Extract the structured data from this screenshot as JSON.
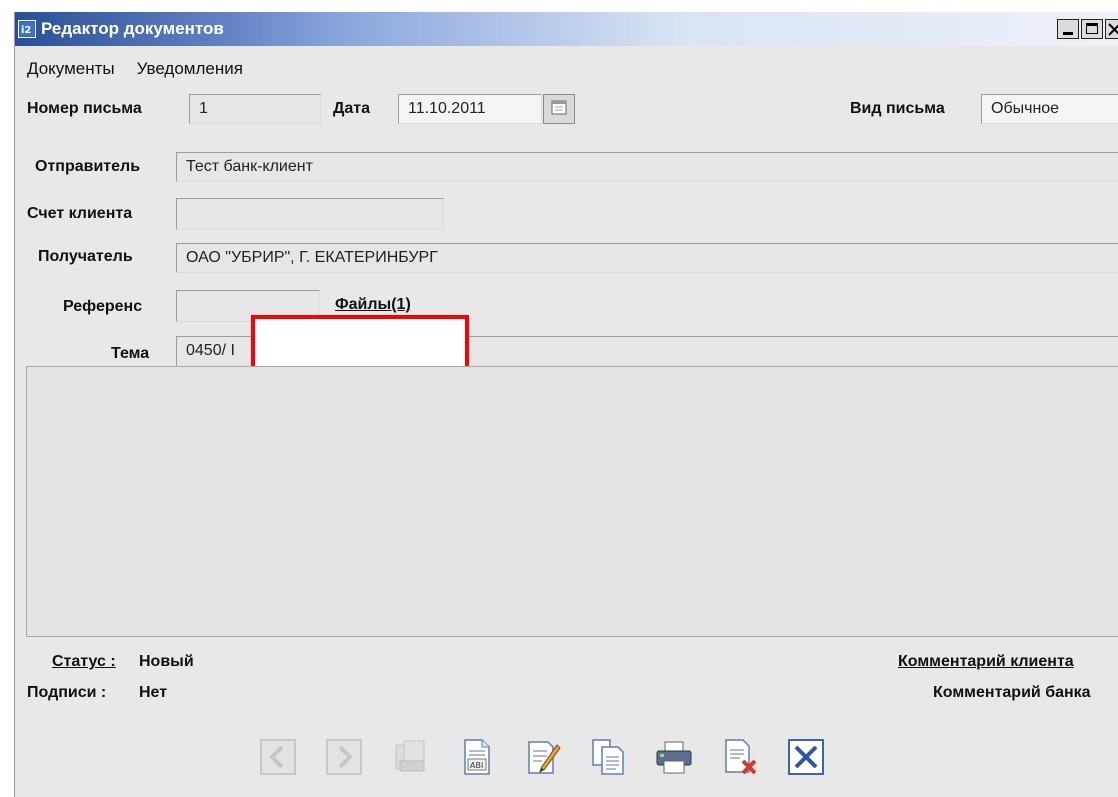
{
  "window": {
    "title": "Редактор документов"
  },
  "menu": [
    "Документы",
    "Уведомления"
  ],
  "form": {
    "letter_number_label": "Номер письма",
    "letter_number_value": "1",
    "date_label": "Дата",
    "date_value": "11.10.2011",
    "letter_type_label": "Вид письма",
    "letter_type_value": "Обычное",
    "sender_label": "Отправитель",
    "sender_value": "Тест банк-клиент",
    "client_account_label": "Счет клиента",
    "client_account_value": "",
    "recipient_label": "Получатель",
    "recipient_value": "ОАО \"УБРИР\", Г. ЕКАТЕРИНБУРГ",
    "reference_label": "Референс",
    "reference_value": "",
    "files_link": "Файлы(1)",
    "subject_label": "Тема",
    "subject_value": "0450/ I",
    "body_text": ""
  },
  "footer": {
    "status_label": "Статус :",
    "status_value": "Новый",
    "signatures_label": "Подписи :",
    "signatures_value": "Нет",
    "client_comment_link": "Комментарий клиента",
    "bank_comment_label": "Комментарий банка"
  },
  "toolbar": [
    {
      "icon": "arrow-left-icon",
      "enabled": false
    },
    {
      "icon": "arrow-right-icon",
      "enabled": false
    },
    {
      "icon": "copy-documents-icon",
      "enabled": false
    },
    {
      "icon": "document-text-icon",
      "enabled": true
    },
    {
      "icon": "edit-pen-icon",
      "enabled": true
    },
    {
      "icon": "document-copy-icon",
      "enabled": true
    },
    {
      "icon": "printer-icon",
      "enabled": true
    },
    {
      "icon": "delete-document-icon",
      "enabled": true
    },
    {
      "icon": "close-x-icon",
      "enabled": true
    }
  ],
  "colors": {
    "title_bar_start": "#2a4f96",
    "redaction_border": "#ff0000",
    "window_bg": "#e8e8e8"
  }
}
